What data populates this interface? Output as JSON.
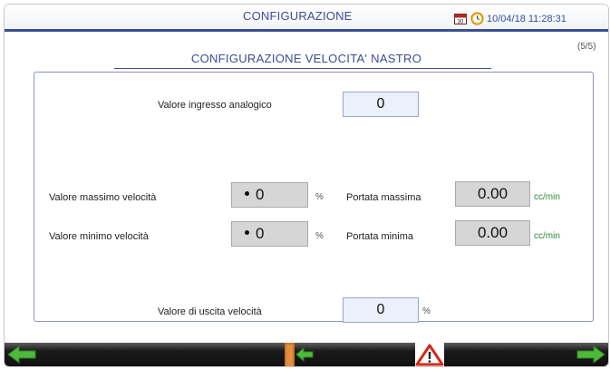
{
  "header": {
    "title": "CONFIGURAZIONE",
    "datetime": "10/04/18 11:28:31",
    "calendar_icon_label": "30"
  },
  "page_indicator": "(5/5)",
  "panel": {
    "title": "CONFIGURAZIONE VELOCITA' NASTRO"
  },
  "fields": {
    "analog_input": {
      "label": "Valore ingresso analogico",
      "value": "0"
    },
    "max_speed": {
      "label": "Valore massimo velocità",
      "value": "0",
      "unit": "%"
    },
    "min_speed": {
      "label": "Valore minimo velocità",
      "value": "0",
      "unit": "%"
    },
    "max_flow": {
      "label": "Portata massima",
      "value": "0.00",
      "unit": "cc/min"
    },
    "min_flow": {
      "label": "Portata minima",
      "value": "0.00",
      "unit": "cc/min"
    },
    "speed_output": {
      "label": "Valore di uscita velocità",
      "value": "0",
      "unit": "%"
    }
  },
  "footer": {
    "buttons": [
      {
        "name": "prev-page-button",
        "icon": "green-arrow-left-icon"
      },
      {
        "name": "exit-button",
        "icon": "exit-door-icon"
      },
      {
        "name": "alarm-button",
        "icon": "warning-triangle-icon"
      },
      {
        "name": "next-page-button",
        "icon": "green-arrow-right-icon"
      }
    ]
  },
  "colors": {
    "accent_blue": "#3d4f93",
    "unit_green": "#2b8a3b",
    "warning_red": "#d42a1c",
    "arrow_green": "#4cbb3a"
  }
}
